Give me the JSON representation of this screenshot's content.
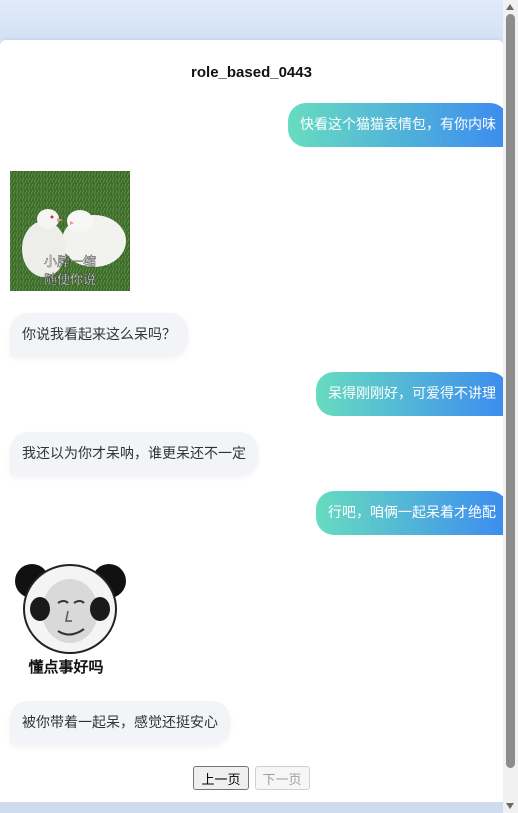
{
  "title": "role_based_0443",
  "messages": [
    {
      "side": "right",
      "type": "text",
      "text": "快看这个猫猫表情包，有你内味"
    },
    {
      "side": "left",
      "type": "image",
      "icon": "pigeon-sticker",
      "caption_line1": "小脖一缩",
      "caption_line2": "随便你说"
    },
    {
      "side": "left",
      "type": "text",
      "text": "你说我看起来这么呆吗？"
    },
    {
      "side": "right",
      "type": "text",
      "text": "呆得刚刚好，可爱得不讲理"
    },
    {
      "side": "left",
      "type": "text",
      "text": "我还以为你才呆呐，谁更呆还不一定"
    },
    {
      "side": "right",
      "type": "text",
      "text": "行吧，咱俩一起呆着才绝配"
    },
    {
      "side": "left",
      "type": "image",
      "icon": "panda-meme-sticker",
      "caption": "懂点事好吗"
    },
    {
      "side": "left",
      "type": "text",
      "text": "被你带着一起呆，感觉还挺安心"
    }
  ],
  "pager": {
    "prev_label": "上一页",
    "next_label": "下一页"
  },
  "colors": {
    "accent_start": "#67dcc0",
    "accent_end": "#3c8bf0",
    "left_bubble": "#f2f4f8"
  }
}
